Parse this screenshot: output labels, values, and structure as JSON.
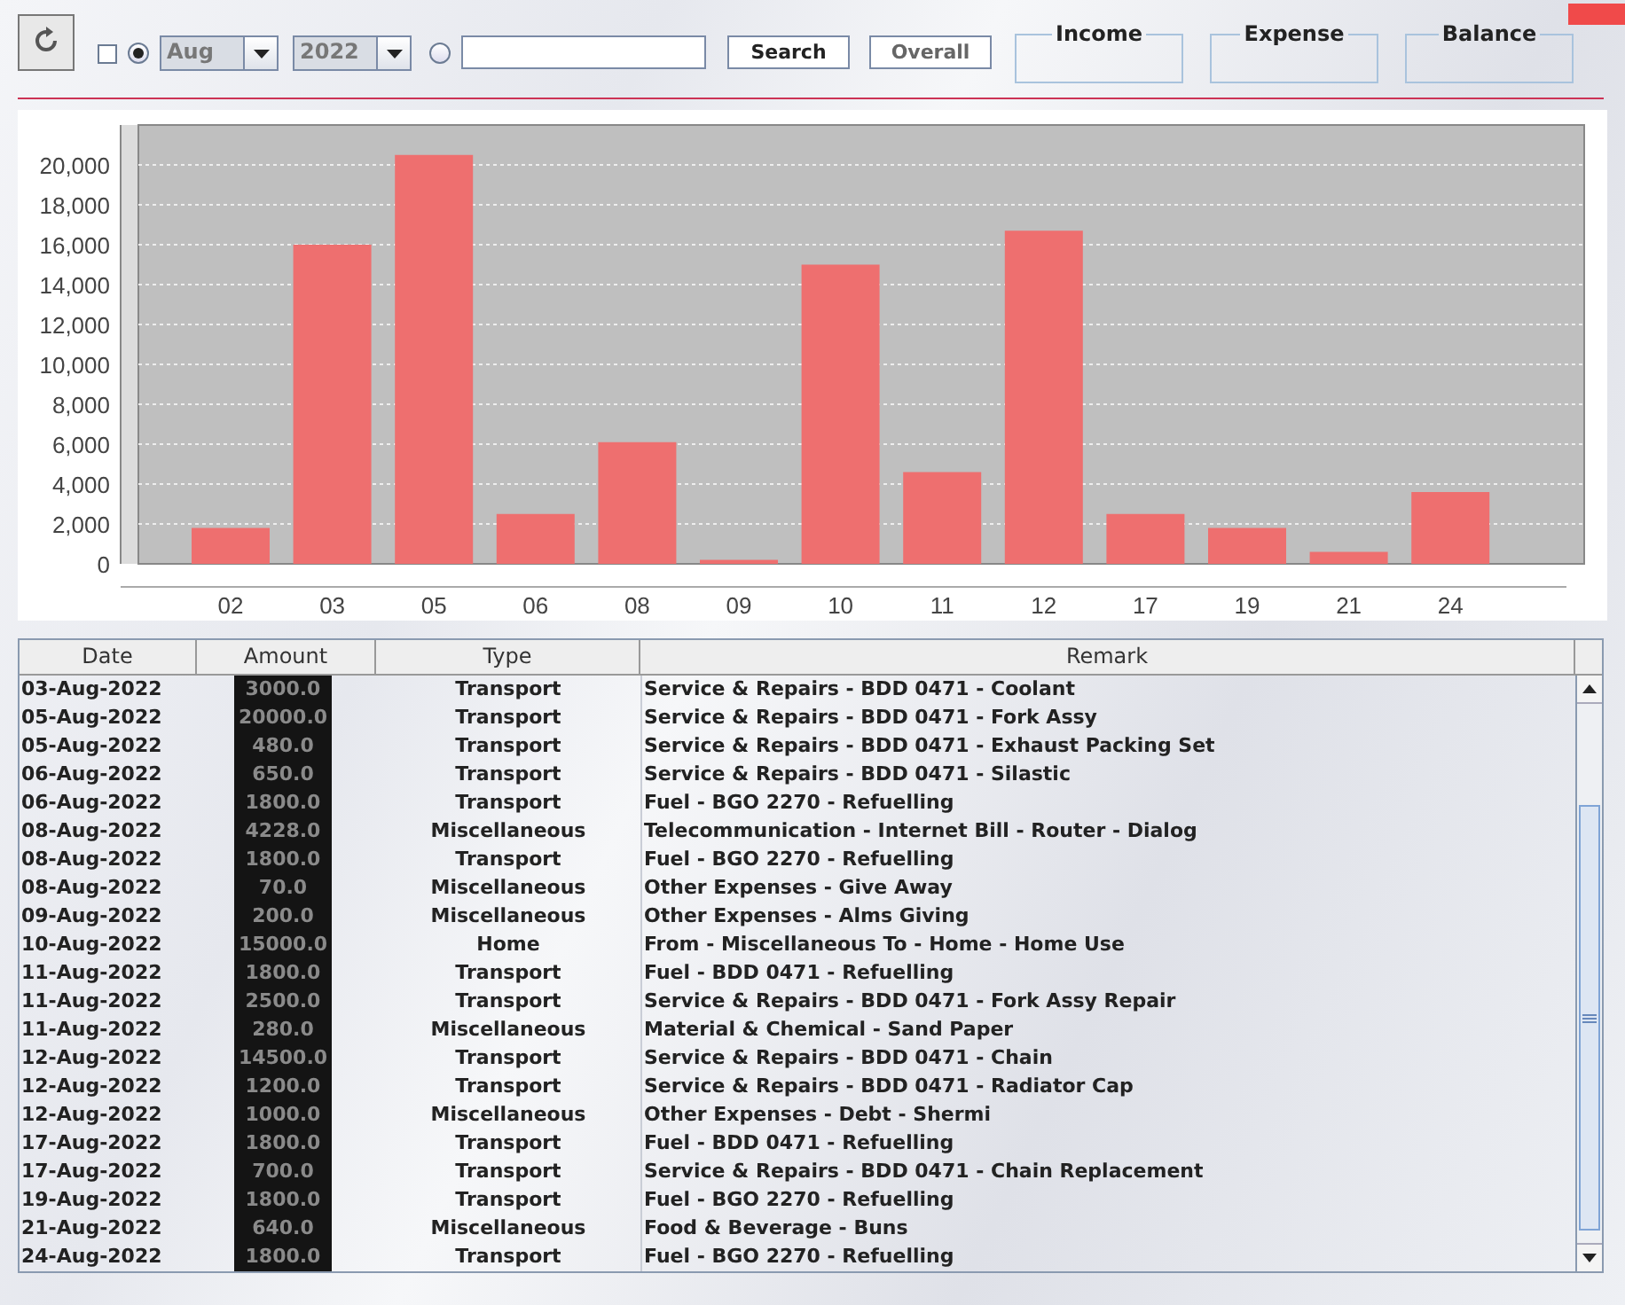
{
  "toolbar": {
    "month_filter": {
      "checked": false
    },
    "month_radio": {
      "selected": true
    },
    "month": "Aug",
    "year": "2022",
    "search_radio": {
      "selected": false
    },
    "search_button": "Search",
    "overall_button": "Overall",
    "summaries": [
      {
        "label": "Income"
      },
      {
        "label": "Expense"
      },
      {
        "label": "Balance"
      }
    ]
  },
  "chart": {
    "chart_data": {
      "type": "bar",
      "grid": true,
      "categories": [
        "02",
        "03",
        "05",
        "06",
        "08",
        "09",
        "10",
        "11",
        "12",
        "17",
        "19",
        "21",
        "24"
      ],
      "series": [
        {
          "color": "#ee6f6f",
          "values": [
            1800,
            16000,
            20500,
            2500,
            6100,
            200,
            15000,
            4600,
            16700,
            2500,
            1800,
            600,
            3600
          ]
        }
      ],
      "ylim": [
        0,
        22000
      ],
      "yticks": [
        {
          "value": 0,
          "label": "0"
        },
        {
          "value": 2000,
          "label": "2,000"
        },
        {
          "value": 4000,
          "label": "4,000"
        },
        {
          "value": 6000,
          "label": "6,000"
        },
        {
          "value": 8000,
          "label": "8,000"
        },
        {
          "value": 10000,
          "label": "10,000"
        },
        {
          "value": 12000,
          "label": "12,000"
        },
        {
          "value": 14000,
          "label": "14,000"
        },
        {
          "value": 16000,
          "label": "16,000"
        },
        {
          "value": 18000,
          "label": "18,000"
        },
        {
          "value": 20000,
          "label": "20,000"
        }
      ]
    }
  },
  "table": {
    "columns": [
      "Date",
      "Amount",
      "Type",
      "Remark"
    ],
    "rows": [
      [
        "03-Aug-2022",
        "3000.0",
        "Transport",
        "Service & Repairs - BDD 0471 - Coolant"
      ],
      [
        "05-Aug-2022",
        "20000.0",
        "Transport",
        "Service & Repairs - BDD 0471 - Fork Assy"
      ],
      [
        "05-Aug-2022",
        "480.0",
        "Transport",
        "Service & Repairs - BDD 0471 - Exhaust Packing Set"
      ],
      [
        "06-Aug-2022",
        "650.0",
        "Transport",
        "Service & Repairs - BDD 0471 - Silastic"
      ],
      [
        "06-Aug-2022",
        "1800.0",
        "Transport",
        "Fuel - BGO 2270 - Refuelling"
      ],
      [
        "08-Aug-2022",
        "4228.0",
        "Miscellaneous",
        "Telecommunication - Internet Bill - Router - Dialog"
      ],
      [
        "08-Aug-2022",
        "1800.0",
        "Transport",
        "Fuel - BGO 2270 - Refuelling"
      ],
      [
        "08-Aug-2022",
        "70.0",
        "Miscellaneous",
        "Other Expenses - Give Away"
      ],
      [
        "09-Aug-2022",
        "200.0",
        "Miscellaneous",
        "Other Expenses - Alms Giving"
      ],
      [
        "10-Aug-2022",
        "15000.0",
        "Home",
        "From - Miscellaneous To - Home - Home Use"
      ],
      [
        "11-Aug-2022",
        "1800.0",
        "Transport",
        "Fuel - BDD 0471 - Refuelling"
      ],
      [
        "11-Aug-2022",
        "2500.0",
        "Transport",
        "Service & Repairs - BDD 0471 - Fork Assy Repair"
      ],
      [
        "11-Aug-2022",
        "280.0",
        "Miscellaneous",
        "Material & Chemical - Sand Paper"
      ],
      [
        "12-Aug-2022",
        "14500.0",
        "Transport",
        "Service & Repairs - BDD 0471 - Chain"
      ],
      [
        "12-Aug-2022",
        "1200.0",
        "Transport",
        "Service & Repairs - BDD 0471 - Radiator Cap"
      ],
      [
        "12-Aug-2022",
        "1000.0",
        "Miscellaneous",
        "Other Expenses - Debt - Shermi"
      ],
      [
        "17-Aug-2022",
        "1800.0",
        "Transport",
        "Fuel - BDD 0471 - Refuelling"
      ],
      [
        "17-Aug-2022",
        "700.0",
        "Transport",
        "Service & Repairs - BDD 0471 - Chain Replacement"
      ],
      [
        "19-Aug-2022",
        "1800.0",
        "Transport",
        "Fuel - BGO 2270 - Refuelling"
      ],
      [
        "21-Aug-2022",
        "640.0",
        "Miscellaneous",
        "Food & Beverage - Buns"
      ],
      [
        "24-Aug-2022",
        "1800.0",
        "Transport",
        "Fuel - BGO 2270 - Refuelling"
      ]
    ]
  }
}
